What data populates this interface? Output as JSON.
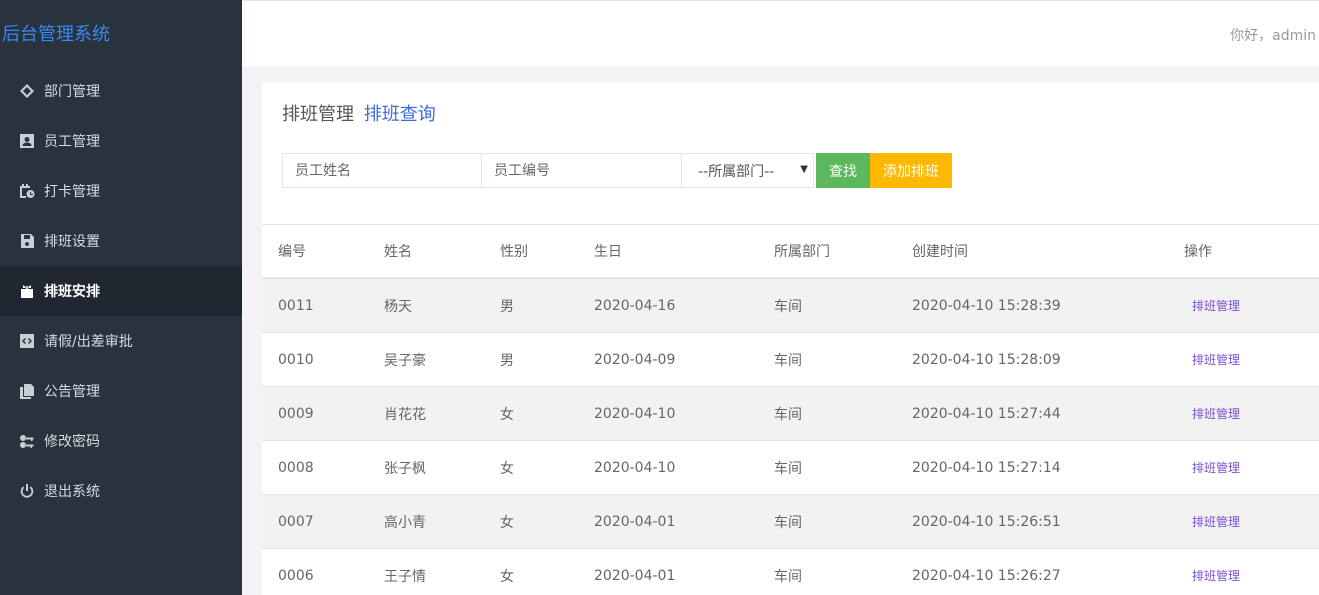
{
  "app": {
    "brand": "后台管理系统"
  },
  "sidebar": {
    "items": [
      {
        "label": "部门管理",
        "icon": "cube-icon"
      },
      {
        "label": "员工管理",
        "icon": "user-card-icon"
      },
      {
        "label": "打卡管理",
        "icon": "calendar-clock-icon"
      },
      {
        "label": "排班设置",
        "icon": "save-icon"
      },
      {
        "label": "排班安排",
        "icon": "box-icon",
        "active": true
      },
      {
        "label": "请假/出差审批",
        "icon": "code-icon"
      },
      {
        "label": "公告管理",
        "icon": "copy-icon"
      },
      {
        "label": "修改密码",
        "icon": "keys-icon"
      },
      {
        "label": "退出系统",
        "icon": "power-icon"
      }
    ]
  },
  "header": {
    "greeting": "你好，admin"
  },
  "breadcrumb": {
    "parent": "排班管理",
    "current": "排班查询"
  },
  "search": {
    "name_placeholder": "员工姓名",
    "id_placeholder": "员工编号",
    "dept_selected": "--所属部门--",
    "search_label": "查找",
    "add_label": "添加排班"
  },
  "table": {
    "headers": {
      "id": "编号",
      "name": "姓名",
      "sex": "性别",
      "birth": "生日",
      "dept": "所属部门",
      "created": "创建时间",
      "op": "操作"
    },
    "rows": [
      {
        "id": "0011",
        "name": "杨天",
        "sex": "男",
        "birth": "2020-04-16",
        "dept": "车间",
        "created": "2020-04-10 15:28:39",
        "op": "排班管理"
      },
      {
        "id": "0010",
        "name": "吴子豪",
        "sex": "男",
        "birth": "2020-04-09",
        "dept": "车间",
        "created": "2020-04-10 15:28:09",
        "op": "排班管理"
      },
      {
        "id": "0009",
        "name": "肖花花",
        "sex": "女",
        "birth": "2020-04-10",
        "dept": "车间",
        "created": "2020-04-10 15:27:44",
        "op": "排班管理"
      },
      {
        "id": "0008",
        "name": "张子枫",
        "sex": "女",
        "birth": "2020-04-10",
        "dept": "车间",
        "created": "2020-04-10 15:27:14",
        "op": "排班管理"
      },
      {
        "id": "0007",
        "name": "高小青",
        "sex": "女",
        "birth": "2020-04-01",
        "dept": "车间",
        "created": "2020-04-10 15:26:51",
        "op": "排班管理"
      },
      {
        "id": "0006",
        "name": "王子情",
        "sex": "女",
        "birth": "2020-04-01",
        "dept": "车间",
        "created": "2020-04-10 15:26:27",
        "op": "排班管理"
      }
    ]
  },
  "colors": {
    "sidebar_bg": "#28333e",
    "brand": "#3a87f5",
    "search_btn": "#5cb85c",
    "add_btn": "#ffb800",
    "link": "#7b4fd4"
  }
}
